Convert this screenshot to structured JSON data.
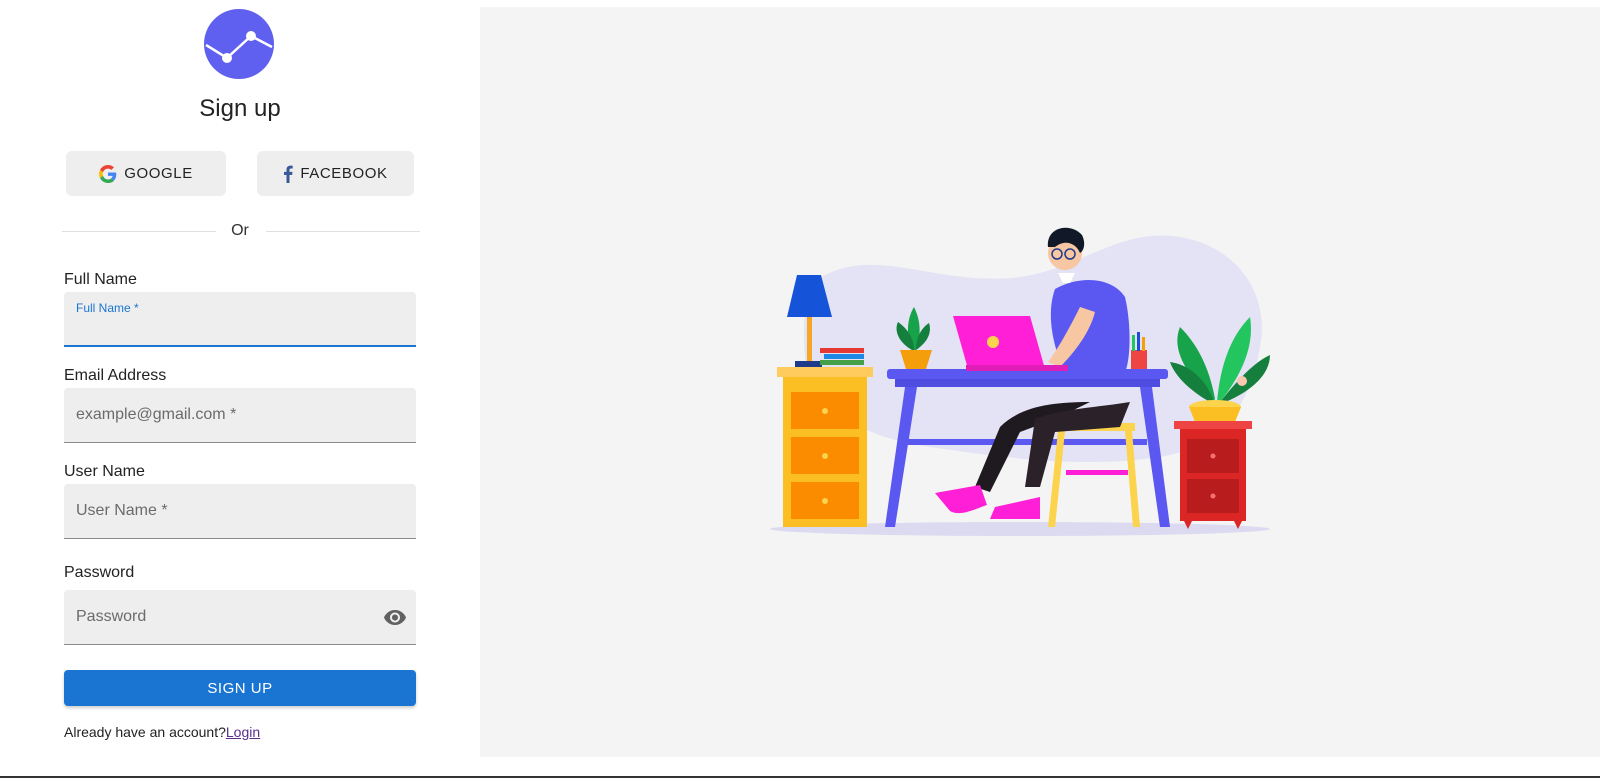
{
  "form": {
    "title": "Sign up",
    "google_label": "GOOGLE",
    "facebook_label": "FACEBOOK",
    "divider_text": "Or",
    "full_name": {
      "label": "Full Name",
      "floating_label": "Full Name *"
    },
    "email": {
      "label": "Email Address",
      "placeholder": "example@gmail.com *"
    },
    "username": {
      "label": "User Name",
      "placeholder": "User Name *"
    },
    "password": {
      "label": "Password",
      "placeholder": "Password"
    },
    "submit_label": "SIGN UP",
    "footer_prompt": "Already have an account?",
    "login_link": "Login"
  },
  "icons": {
    "logo": "chart-line-logo-icon",
    "google": "google-g-icon",
    "facebook": "facebook-f-icon",
    "password_toggle": "eye-icon"
  },
  "colors": {
    "brand_purple": "#5f5ff0",
    "primary_blue": "#1a75d2",
    "panel_bg": "#f4f4f4",
    "field_bg": "#eeeeee"
  }
}
